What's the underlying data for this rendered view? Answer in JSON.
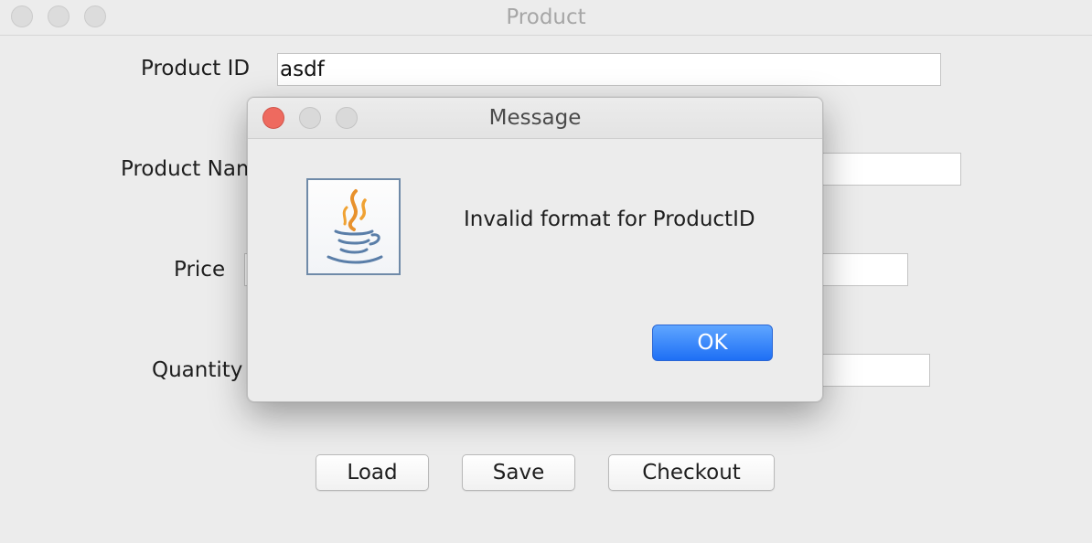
{
  "window": {
    "title": "Product"
  },
  "form": {
    "product_id": {
      "label": "Product ID",
      "value": "asdf"
    },
    "product_name": {
      "label": "Product Name",
      "label_visible": "Product Na",
      "value": ""
    },
    "price": {
      "label": "Price",
      "value": ""
    },
    "quantity": {
      "label": "Quantity",
      "label_visible": "Quantity",
      "value": ""
    }
  },
  "buttons": {
    "load": "Load",
    "save": "Save",
    "checkout": "Checkout"
  },
  "dialog": {
    "title": "Message",
    "message": "Invalid format for ProductID",
    "ok_label": "OK",
    "icon": "java-icon"
  },
  "colors": {
    "close_red": "#ee6a5f",
    "accent_blue": "#1e6ff5"
  }
}
